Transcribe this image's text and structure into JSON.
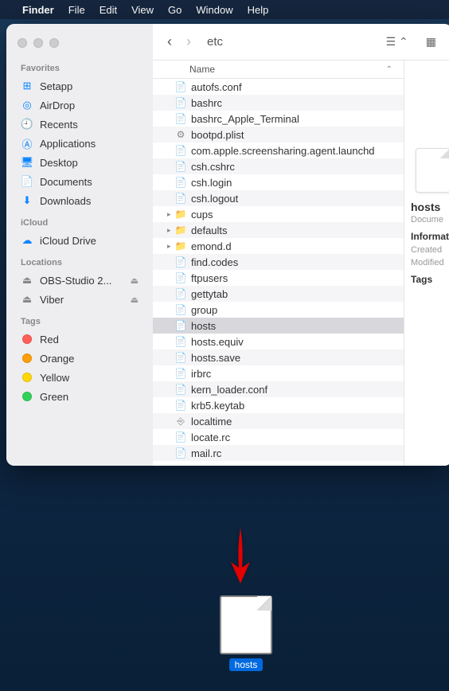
{
  "menubar": {
    "app": "Finder",
    "items": [
      "File",
      "Edit",
      "View",
      "Go",
      "Window",
      "Help"
    ]
  },
  "toolbar": {
    "location": "etc"
  },
  "sidebar": {
    "favorites": {
      "heading": "Favorites",
      "items": [
        {
          "icon": "grid",
          "label": "Setapp"
        },
        {
          "icon": "airdrop",
          "label": "AirDrop"
        },
        {
          "icon": "clock",
          "label": "Recents"
        },
        {
          "icon": "app",
          "label": "Applications"
        },
        {
          "icon": "desktop",
          "label": "Desktop"
        },
        {
          "icon": "doc",
          "label": "Documents"
        },
        {
          "icon": "download",
          "label": "Downloads"
        }
      ]
    },
    "icloud": {
      "heading": "iCloud",
      "items": [
        {
          "icon": "cloud",
          "label": "iCloud Drive"
        }
      ]
    },
    "locations": {
      "heading": "Locations",
      "items": [
        {
          "icon": "disk",
          "label": "OBS-Studio 2...",
          "eject": true
        },
        {
          "icon": "disk",
          "label": "Viber",
          "eject": true
        }
      ]
    },
    "tags": {
      "heading": "Tags",
      "items": [
        {
          "color": "#ff5f57",
          "label": "Red"
        },
        {
          "color": "#ff9f0a",
          "label": "Orange"
        },
        {
          "color": "#ffd60a",
          "label": "Yellow"
        },
        {
          "color": "#30d158",
          "label": "Green"
        }
      ]
    }
  },
  "col": {
    "header": "Name"
  },
  "files": [
    {
      "name": "autofs.conf",
      "type": "file"
    },
    {
      "name": "bashrc",
      "type": "file"
    },
    {
      "name": "bashrc_Apple_Terminal",
      "type": "file"
    },
    {
      "name": "bootpd.plist",
      "type": "plist"
    },
    {
      "name": "com.apple.screensharing.agent.launchd",
      "type": "file"
    },
    {
      "name": "csh.cshrc",
      "type": "file"
    },
    {
      "name": "csh.login",
      "type": "file"
    },
    {
      "name": "csh.logout",
      "type": "file"
    },
    {
      "name": "cups",
      "type": "folder",
      "expandable": true
    },
    {
      "name": "defaults",
      "type": "folder",
      "expandable": true
    },
    {
      "name": "emond.d",
      "type": "folder",
      "expandable": true
    },
    {
      "name": "find.codes",
      "type": "file"
    },
    {
      "name": "ftpusers",
      "type": "file"
    },
    {
      "name": "gettytab",
      "type": "file"
    },
    {
      "name": "group",
      "type": "file"
    },
    {
      "name": "hosts",
      "type": "file",
      "selected": true
    },
    {
      "name": "hosts.equiv",
      "type": "file"
    },
    {
      "name": "hosts.save",
      "type": "file"
    },
    {
      "name": "irbrc",
      "type": "file"
    },
    {
      "name": "kern_loader.conf",
      "type": "file"
    },
    {
      "name": "krb5.keytab",
      "type": "file"
    },
    {
      "name": "localtime",
      "type": "exec"
    },
    {
      "name": "locate.rc",
      "type": "file"
    },
    {
      "name": "mail.rc",
      "type": "file"
    }
  ],
  "info": {
    "name": "hosts",
    "kind": "Docume",
    "h_info": "Informat",
    "l_created": "Created",
    "l_modified": "Modified",
    "h_tags": "Tags"
  },
  "desktop_file": {
    "label": "hosts"
  }
}
